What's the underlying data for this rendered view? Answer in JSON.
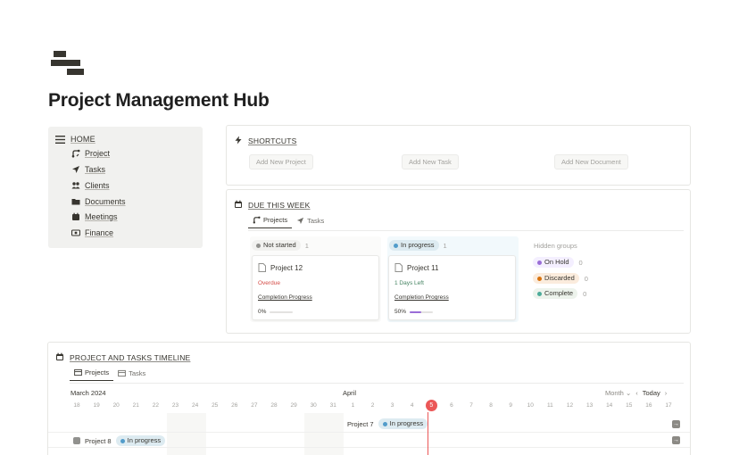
{
  "page": {
    "title": "Project Management Hub"
  },
  "nav": {
    "home_label": "HOME",
    "items": [
      {
        "label": "Project",
        "icon": "project-icon"
      },
      {
        "label": "Tasks",
        "icon": "send-icon"
      },
      {
        "label": "Clients",
        "icon": "people-icon"
      },
      {
        "label": "Documents",
        "icon": "folder-icon"
      },
      {
        "label": "Meetings",
        "icon": "calendar-icon"
      },
      {
        "label": "Finance",
        "icon": "money-icon"
      }
    ]
  },
  "shortcuts": {
    "title": "SHORTCUTS",
    "buttons": [
      "Add New Project",
      "Add New Task",
      "Add New Document"
    ]
  },
  "due": {
    "title": "DUE THIS WEEK",
    "tabs": [
      "Projects",
      "Tasks"
    ],
    "groups": [
      {
        "label": "Not started",
        "count": "1",
        "color": "#91918e",
        "bg": "#f1f1ef",
        "card": {
          "title": "Project 12",
          "status": "Overdue",
          "status_color": "#d44c47",
          "progress_label": "Completion Progress",
          "progress_text": "0%",
          "progress": 0
        }
      },
      {
        "label": "In progress",
        "count": "1",
        "color": "#529cca",
        "bg": "#e7f3f8",
        "card": {
          "title": "Project 11",
          "status": "1 Days Left",
          "status_color": "#448361",
          "progress_label": "Completion Progress",
          "progress_text": "50%",
          "progress": 0.5
        }
      }
    ],
    "hidden_title": "Hidden groups",
    "hidden": [
      {
        "label": "On Hold",
        "count": "0",
        "color": "#9a6dd7",
        "bg": "#f4efff"
      },
      {
        "label": "Discarded",
        "count": "0",
        "color": "#d9730d",
        "bg": "#fbecdd"
      },
      {
        "label": "Complete",
        "count": "0",
        "color": "#4dab9a",
        "bg": "#edf3ec"
      }
    ]
  },
  "timeline": {
    "title": "PROJECT AND TASKS TIMELINE",
    "tabs": [
      "Projects",
      "Tasks"
    ],
    "month_left": "March 2024",
    "month_mid": "April",
    "view_label": "Month",
    "today_label": "Today",
    "days": [
      "18",
      "19",
      "20",
      "21",
      "22",
      "23",
      "24",
      "25",
      "26",
      "27",
      "28",
      "29",
      "30",
      "31",
      "1",
      "2",
      "3",
      "4",
      "5",
      "6",
      "7",
      "8",
      "9",
      "10",
      "11",
      "12",
      "13",
      "14",
      "15",
      "16",
      "17"
    ],
    "today_index": 18,
    "items": [
      {
        "label": "Project 7",
        "status": "In progress"
      },
      {
        "label": "Project 8",
        "status": "In progress"
      }
    ]
  }
}
